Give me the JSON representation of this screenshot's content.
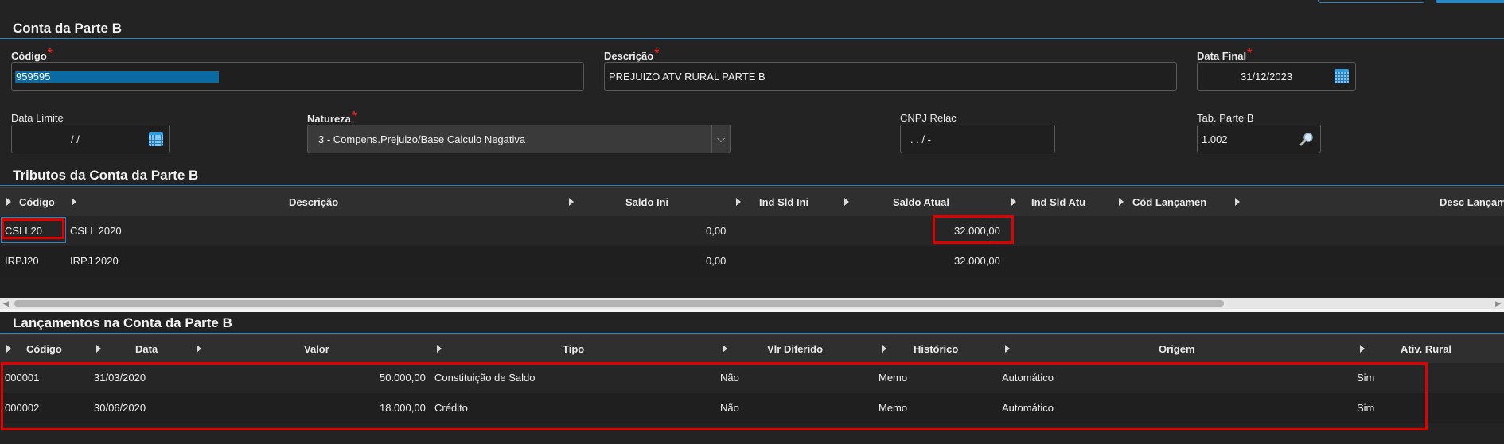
{
  "conta": {
    "title": "Conta da Parte B",
    "codigo_label": "Código",
    "codigo_value": "959595",
    "descricao_label": "Descrição",
    "descricao_value": "PREJUIZO ATV RURAL PARTE B",
    "data_final_label": "Data Final",
    "data_final_value": "31/12/2023",
    "data_limite_label": "Data Limite",
    "data_limite_value": "/ /",
    "natureza_label": "Natureza",
    "natureza_value": "3 - Compens.Prejuizo/Base Calculo Negativa",
    "cnpj_label": "CNPJ Relac",
    "cnpj_value": ". . / -",
    "tab_label": "Tab. Parte B",
    "tab_value": "1.002",
    "required_mark": "*",
    "select_arrow": "⌵"
  },
  "tributos": {
    "title": "Tributos da Conta da Parte B",
    "headers": [
      "Código",
      "Descrição",
      "Saldo Ini",
      "Ind Sld Ini",
      "Saldo Atual",
      "Ind Sld Atu",
      "Cód Lançamen",
      "Desc Lançam"
    ],
    "rows": [
      {
        "codigo": "CSLL20",
        "descricao": "CSLL 2020",
        "saldo_ini": "0,00",
        "saldo_atual": "32.000,00"
      },
      {
        "codigo": "IRPJ20",
        "descricao": "IRPJ 2020",
        "saldo_ini": "0,00",
        "saldo_atual": "32.000,00"
      }
    ]
  },
  "lancamentos": {
    "title": "Lançamentos na Conta da Parte B",
    "headers": [
      "Código",
      "Data",
      "Valor",
      "Tipo",
      "Vlr Diferido",
      "Histórico",
      "Origem",
      "Ativ. Rural"
    ],
    "rows": [
      {
        "codigo": "000001",
        "data": "31/03/2020",
        "valor": "50.000,00",
        "tipo": "Constituição de Saldo",
        "vlr_diferido": "Não",
        "historico": "Memo",
        "origem": "Automático",
        "ativ_rural": "Sim"
      },
      {
        "codigo": "000002",
        "data": "30/06/2020",
        "valor": "18.000,00",
        "tipo": "Crédito",
        "vlr_diferido": "Não",
        "historico": "Memo",
        "origem": "Automático",
        "ativ_rural": "Sim"
      }
    ]
  },
  "icons": {
    "calendar": "calendar-icon",
    "lookup": "lookup-magnifier-icon",
    "sort": "column-sort-triangle-icon"
  },
  "colors": {
    "accent": "#2b86c7",
    "highlight": "#e00000",
    "required": "#e31b1b",
    "selection": "#0a6aa1"
  }
}
